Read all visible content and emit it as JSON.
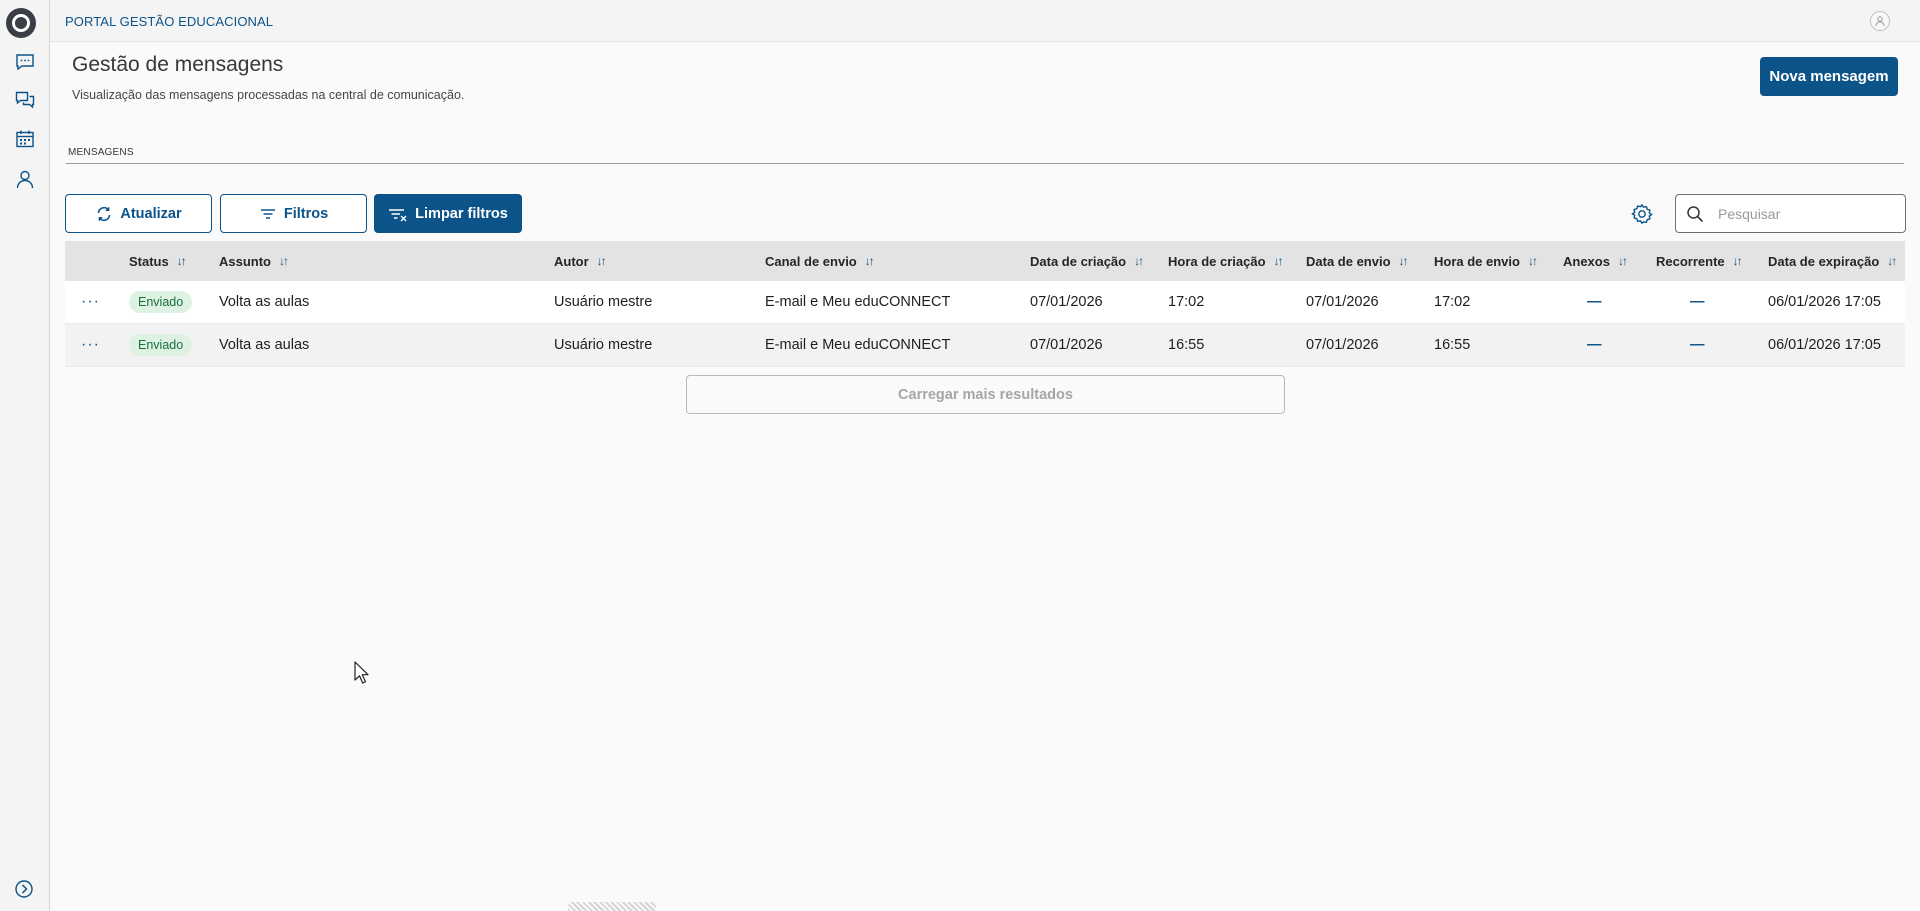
{
  "app": {
    "title": "PORTAL GESTÃO EDUCACIONAL"
  },
  "sidebar": {
    "items": [
      {
        "name": "messages-icon"
      },
      {
        "name": "chat-icon"
      },
      {
        "name": "calendar-icon"
      },
      {
        "name": "user-icon"
      }
    ],
    "expand_icon": "chevron-right-circle-icon"
  },
  "page": {
    "title": "Gestão de mensagens",
    "subtitle": "Visualização das mensagens processadas na central de comunicação.",
    "new_button": "Nova mensagem"
  },
  "tabs": [
    {
      "label": "MENSAGENS",
      "active": true
    }
  ],
  "toolbar": {
    "refresh_label": "Atualizar",
    "filters_label": "Filtros",
    "clear_filters_label": "Limpar filtros",
    "search_placeholder": "Pesquisar"
  },
  "table": {
    "columns": [
      "Status",
      "Assunto",
      "Autor",
      "Canal de envio",
      "Data de criação",
      "Hora de criação",
      "Data de envio",
      "Hora de envio",
      "Anexos",
      "Recorrente",
      "Data de expiração"
    ],
    "rows": [
      {
        "status": "Enviado",
        "assunto": "Volta as aulas",
        "autor": "Usuário mestre",
        "canal": "E-mail e Meu eduCONNECT",
        "data_criacao": "07/01/2026",
        "hora_criacao": "17:02",
        "data_envio": "07/01/2026",
        "hora_envio": "17:02",
        "anexos": "—",
        "recorrente": "—",
        "data_expiracao": "06/01/2026 17:05"
      },
      {
        "status": "Enviado",
        "assunto": "Volta as aulas",
        "autor": "Usuário mestre",
        "canal": "E-mail e Meu eduCONNECT",
        "data_criacao": "07/01/2026",
        "hora_criacao": "16:55",
        "data_envio": "07/01/2026",
        "hora_envio": "16:55",
        "anexos": "—",
        "recorrente": "—",
        "data_expiracao": "06/01/2026 17:05"
      }
    ],
    "load_more_label": "Carregar mais resultados"
  },
  "colors": {
    "primary": "#0c5389",
    "status_success_bg": "#def2e4",
    "status_success_text": "#17703a"
  }
}
